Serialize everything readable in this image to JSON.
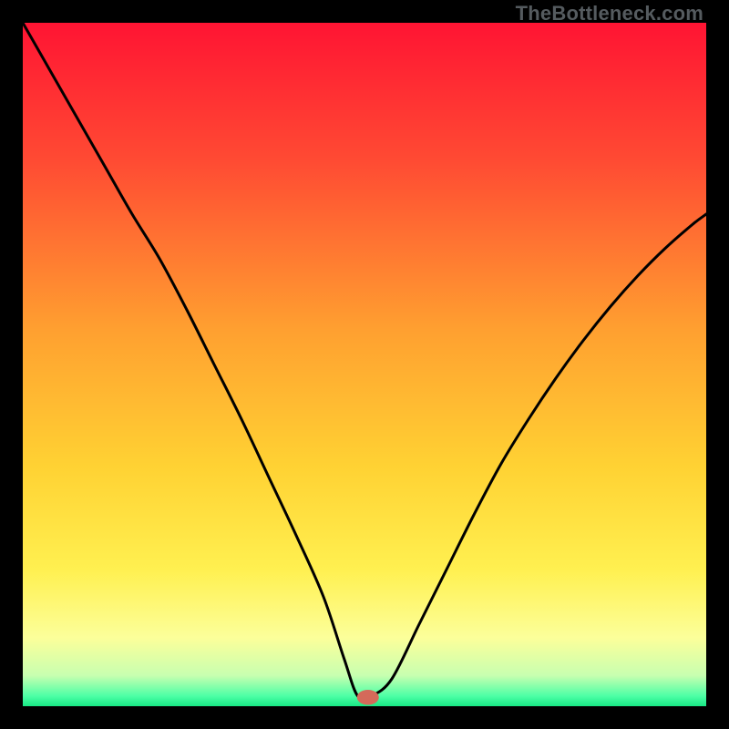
{
  "watermark": "TheBottleneck.com",
  "chart_data": {
    "type": "line",
    "title": "",
    "xlabel": "",
    "ylabel": "",
    "xlim": [
      0,
      100
    ],
    "ylim": [
      0,
      100
    ],
    "grid": false,
    "background": {
      "type": "vertical-gradient",
      "stops": [
        {
          "pos": 0.0,
          "color": "#ff1433"
        },
        {
          "pos": 0.2,
          "color": "#ff4a33"
        },
        {
          "pos": 0.45,
          "color": "#ffa030"
        },
        {
          "pos": 0.65,
          "color": "#ffd233"
        },
        {
          "pos": 0.8,
          "color": "#fff050"
        },
        {
          "pos": 0.9,
          "color": "#fcff9a"
        },
        {
          "pos": 0.955,
          "color": "#c8ffb0"
        },
        {
          "pos": 0.985,
          "color": "#4dffa6"
        },
        {
          "pos": 1.0,
          "color": "#18e884"
        }
      ]
    },
    "series": [
      {
        "name": "bottleneck-curve",
        "color": "#000000",
        "x": [
          0,
          4,
          8,
          12,
          16,
          20,
          24,
          28,
          32,
          36,
          40,
          44,
          47,
          49,
          51,
          54,
          58,
          62,
          66,
          70,
          74,
          78,
          82,
          86,
          90,
          94,
          98,
          100
        ],
        "y": [
          100,
          93,
          86,
          79,
          72,
          65.5,
          58,
          50,
          42,
          33.5,
          25,
          16,
          7,
          1.5,
          1.5,
          4,
          12,
          20,
          28,
          35.5,
          42,
          48,
          53.5,
          58.5,
          63,
          67,
          70.5,
          72
        ]
      }
    ],
    "marker": {
      "name": "bottleneck-point",
      "x": 50.5,
      "y": 1.3,
      "rx": 1.6,
      "ry": 1.1,
      "color": "#d46a5a"
    }
  }
}
